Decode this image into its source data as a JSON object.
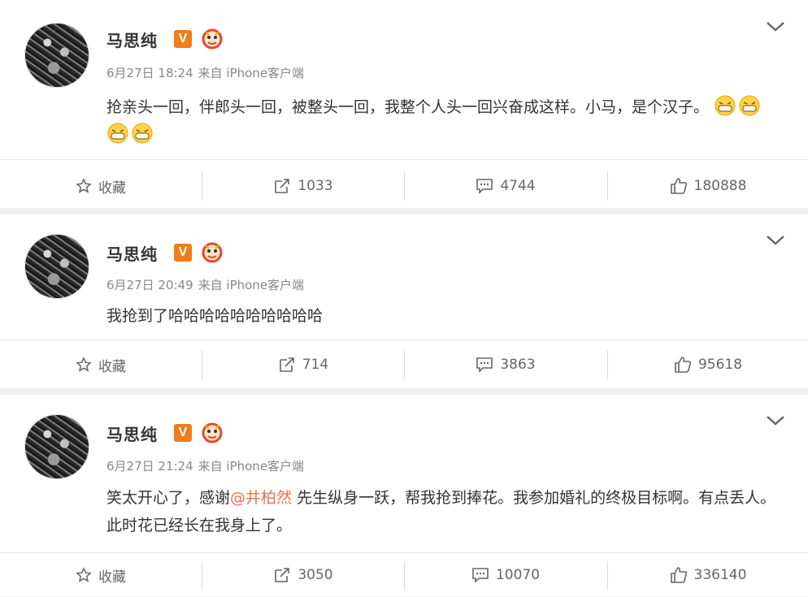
{
  "posts": [
    {
      "user_name": "马思纯",
      "badge_v": "V",
      "date": "6月27日 18:24",
      "source": "来自 iPhone客户端",
      "text_parts": [
        "抢亲头一回，伴郎头一回，被整头一回，我整个人头一回兴奋成这样。小马，是个汉子。"
      ],
      "emoji_count": 4,
      "actions": {
        "favorite": "收藏",
        "repost": "1033",
        "comment": "4744",
        "like": "180888"
      }
    },
    {
      "user_name": "马思纯",
      "badge_v": "V",
      "date": "6月27日 20:49",
      "source": "来自 iPhone客户端",
      "text_parts": [
        "我抢到了哈哈哈哈哈哈哈哈哈哈"
      ],
      "emoji_count": 0,
      "actions": {
        "favorite": "收藏",
        "repost": "714",
        "comment": "3863",
        "like": "95618"
      }
    },
    {
      "user_name": "马思纯",
      "badge_v": "V",
      "date": "6月27日 21:24",
      "source": "来自 iPhone客户端",
      "text_before": "笑太开心了，感谢",
      "mention": "@井柏然",
      "text_after": " 先生纵身一跃，帮我抢到捧花。我参加婚礼的终极目标啊。有点丢人。此时花已经长在我身上了。",
      "emoji_count": 0,
      "actions": {
        "favorite": "收藏",
        "repost": "3050",
        "comment": "10070",
        "like": "336140"
      }
    }
  ],
  "icons": {
    "favorite": "star-outline-icon",
    "repost": "share-arrow-icon",
    "comment": "comment-bubble-icon",
    "like": "thumb-up-icon",
    "menu": "chevron-down-icon",
    "emoji": "grin-emoji-icon"
  },
  "colors": {
    "verified_badge": "#ef7d1a",
    "mention": "#eb7350",
    "meta_text": "#888888",
    "background": "#eef0f3"
  }
}
